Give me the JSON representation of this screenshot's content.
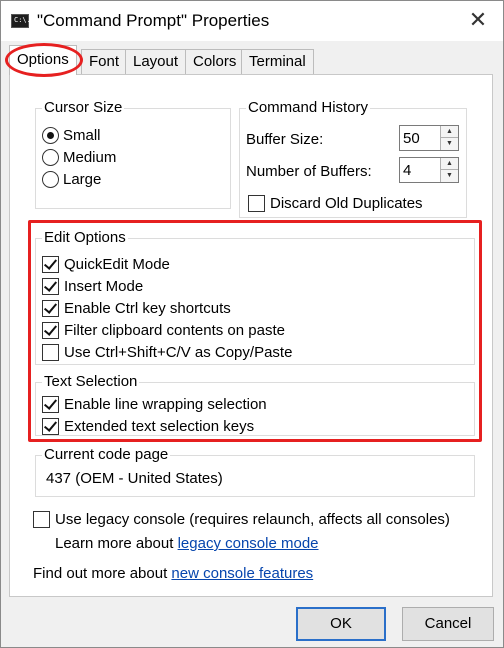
{
  "window": {
    "title": "\"Command Prompt\" Properties",
    "icon_text": "C:\\."
  },
  "tabs": [
    {
      "label": "Options"
    },
    {
      "label": "Font"
    },
    {
      "label": "Layout"
    },
    {
      "label": "Colors"
    },
    {
      "label": "Terminal"
    }
  ],
  "cursor_size": {
    "title": "Cursor Size",
    "options": [
      {
        "label": "Small",
        "selected": true
      },
      {
        "label": "Medium",
        "selected": false
      },
      {
        "label": "Large",
        "selected": false
      }
    ]
  },
  "command_history": {
    "title": "Command History",
    "buffer_size_label": "Buffer Size:",
    "buffer_size_value": "50",
    "num_buffers_label": "Number of Buffers:",
    "num_buffers_value": "4",
    "discard_label": "Discard Old Duplicates",
    "discard_checked": false
  },
  "edit_options": {
    "title": "Edit Options",
    "items": [
      {
        "label": "QuickEdit Mode",
        "checked": true
      },
      {
        "label": "Insert Mode",
        "checked": true
      },
      {
        "label": "Enable Ctrl key shortcuts",
        "checked": true
      },
      {
        "label": "Filter clipboard contents on paste",
        "checked": true
      },
      {
        "label": "Use Ctrl+Shift+C/V as Copy/Paste",
        "checked": false
      }
    ]
  },
  "text_selection": {
    "title": "Text Selection",
    "items": [
      {
        "label": "Enable line wrapping selection",
        "checked": true
      },
      {
        "label": "Extended text selection keys",
        "checked": true
      }
    ]
  },
  "code_page": {
    "title": "Current code page",
    "value": "437   (OEM - United States)"
  },
  "legacy": {
    "checkbox_label": "Use legacy console (requires relaunch, affects all consoles)",
    "checked": false,
    "learn_prefix": "Learn more about",
    "learn_link": "legacy console mode"
  },
  "find_out": {
    "prefix": "Find out more about",
    "link": "new console features"
  },
  "buttons": {
    "ok": "OK",
    "cancel": "Cancel"
  },
  "colors": {
    "highlight": "#e62020",
    "link": "#0645ad"
  }
}
